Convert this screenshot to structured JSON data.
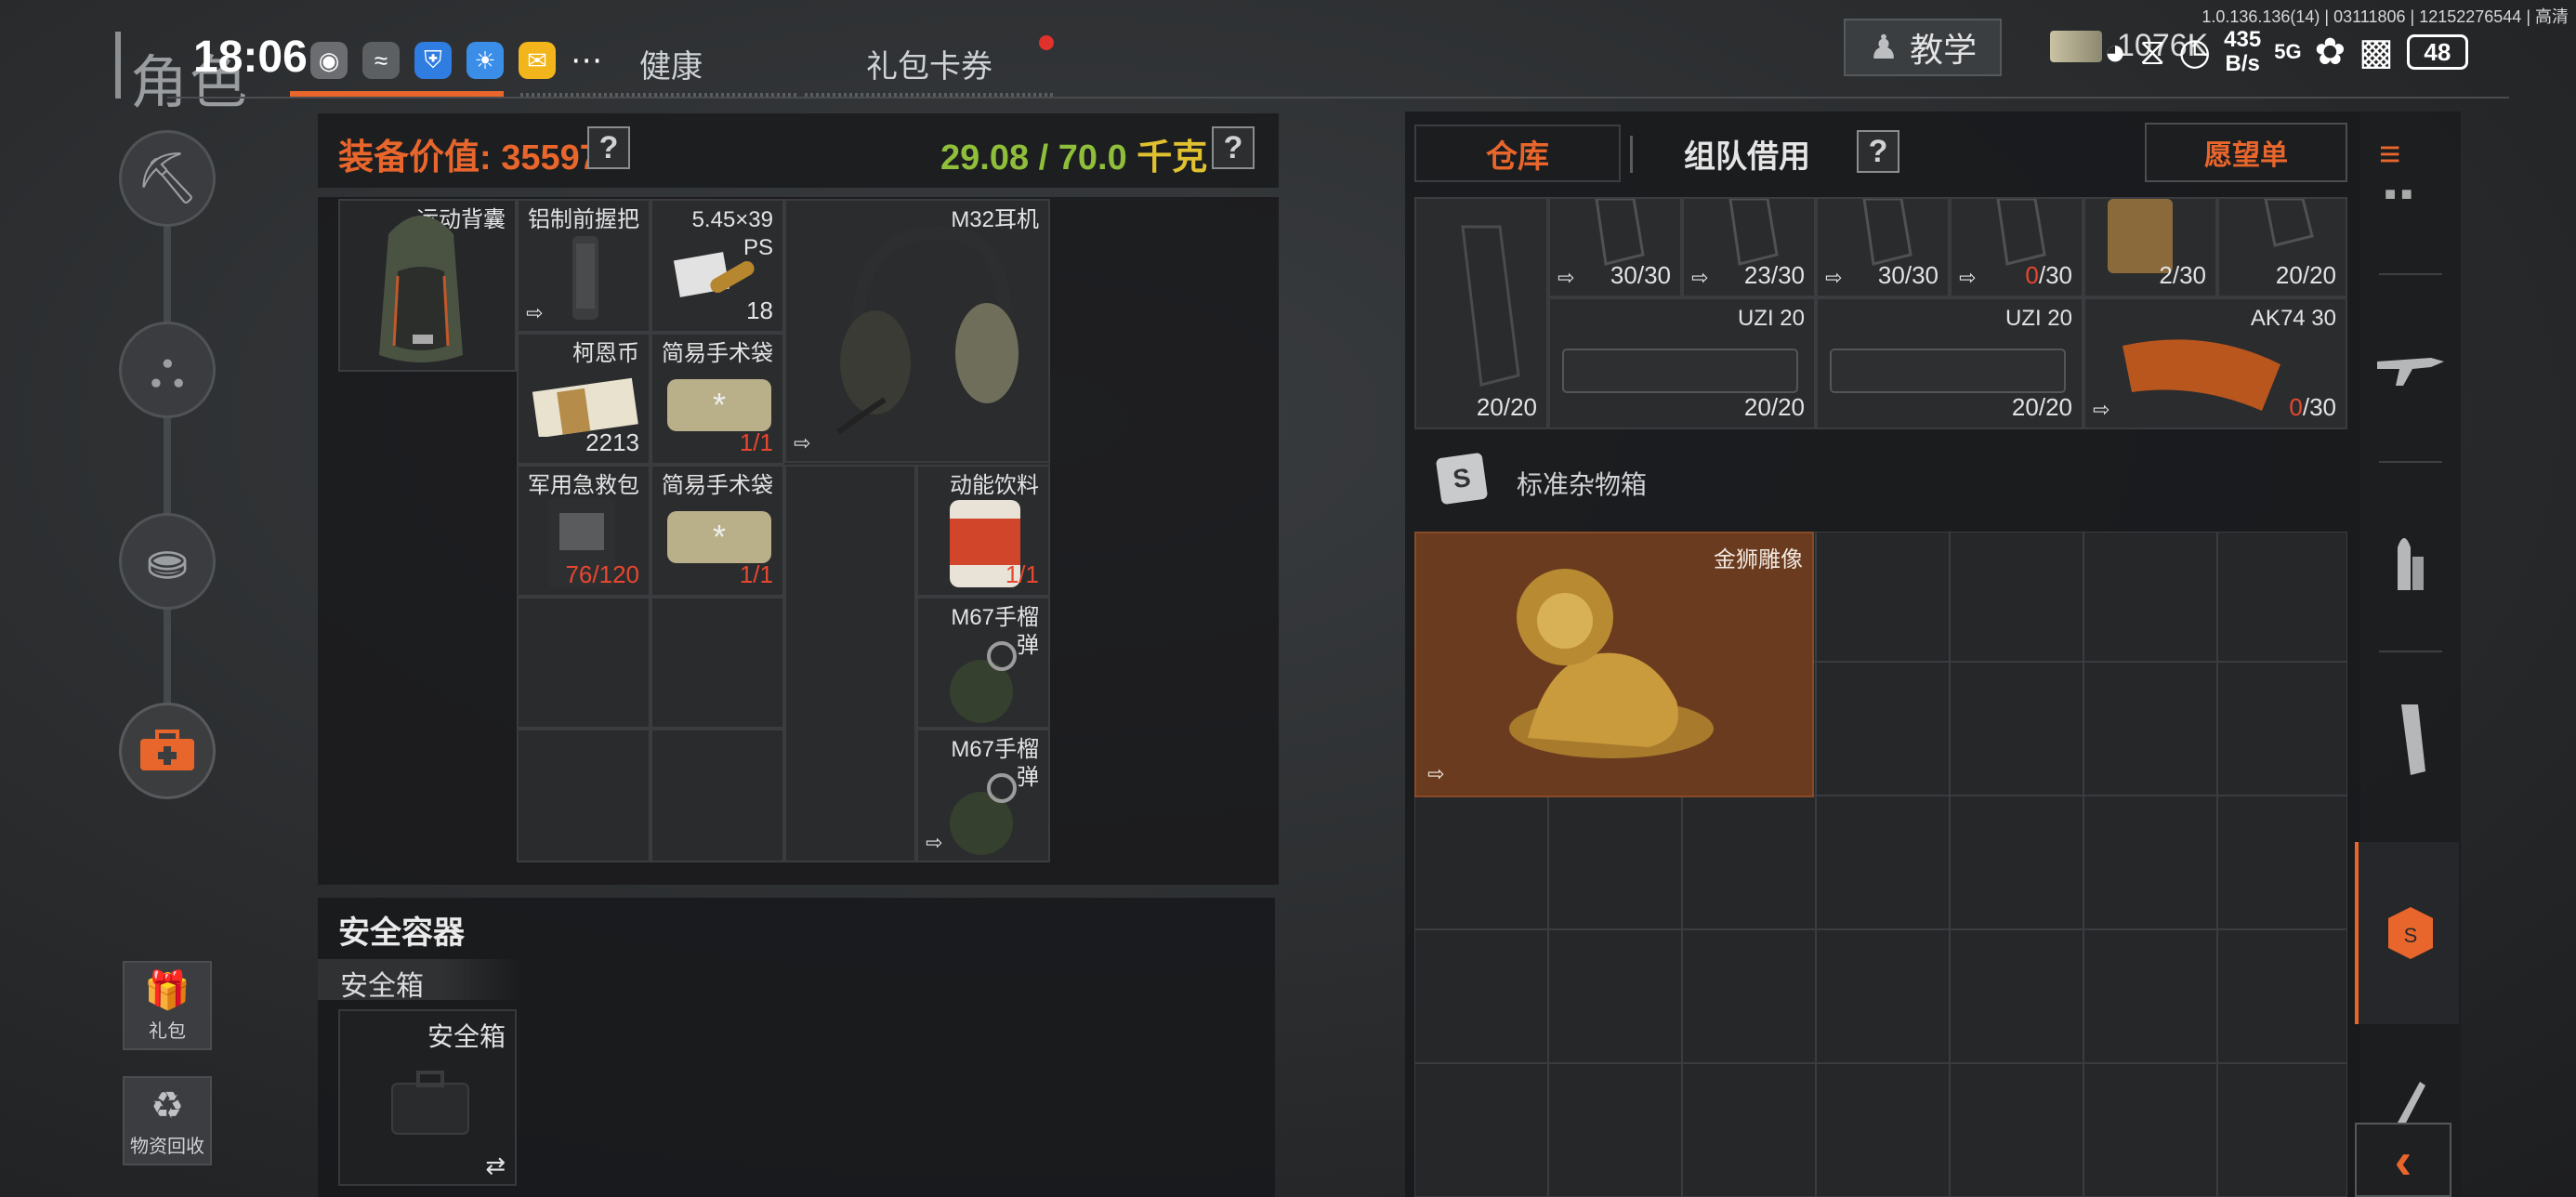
{
  "header": {
    "title": "角色",
    "tabs": [
      {
        "label": "健康"
      },
      {
        "label": "礼包卡券"
      }
    ],
    "tutorial_label": "教学",
    "currency": "1076K"
  },
  "status_bar": {
    "time": "18:06",
    "net_speed_value": "435",
    "net_speed_unit": "B/s",
    "signal": "5G",
    "battery": "48",
    "version": "1.0.136.136(14) | 03111806 | 12152276544 | 高清"
  },
  "left_nav": {
    "items": [
      {
        "name": "helmet-weapon-icon"
      },
      {
        "name": "vest-icon"
      },
      {
        "name": "backpack-icon"
      },
      {
        "name": "medkit-icon",
        "active": true
      }
    ],
    "gift_label": "礼包",
    "recycle_label": "物资回收"
  },
  "equipment": {
    "value_label": "装备价值: 35597",
    "weight_value": "29.08 / 70.0",
    "weight_unit": "千克",
    "help": "?",
    "backpack": {
      "name": "运动背囊"
    },
    "items": {
      "grip": {
        "name": "铝制前握把"
      },
      "ammo": {
        "name": "5.45×39 PS",
        "qty": "18"
      },
      "headset": {
        "name": "M32耳机"
      },
      "coin": {
        "name": "柯恩币",
        "qty": "2213"
      },
      "surgical1": {
        "name": "简易手术袋",
        "qty": "1/1"
      },
      "firstaid": {
        "name": "军用急救包",
        "qty": "76/120"
      },
      "surgical2": {
        "name": "简易手术袋",
        "qty": "1/1"
      },
      "drink": {
        "name": "动能饮料",
        "qty": "1/1"
      },
      "grenade1": {
        "name": "M67手榴弹"
      },
      "grenade2": {
        "name": "M67手榴弹"
      }
    }
  },
  "safe": {
    "title": "安全容器",
    "sub_label": "安全箱",
    "box_label": "安全箱",
    "swap_icon": "⇄"
  },
  "warehouse": {
    "tab_active": "仓库",
    "tab_team": "组队借用",
    "help": "?",
    "wishlist": "愿望单",
    "mags_row1": [
      {
        "qty": "30/30"
      },
      {
        "qty": "23/30"
      },
      {
        "qty": "30/30"
      },
      {
        "qty_red": "0",
        "qty_rest": "/30"
      },
      {
        "qty": "2/30"
      },
      {
        "qty": "20/20"
      }
    ],
    "mag_big_qty": "20/20",
    "mags_row2": [
      {
        "name": "UZI 20",
        "qty": "20/20"
      },
      {
        "name": "UZI 20",
        "qty": "20/20"
      },
      {
        "name": "AK74 30",
        "qty_red": "0",
        "qty_rest": "/30"
      }
    ],
    "misc_box_title": "标准杂物箱",
    "lion": {
      "name": "金狮雕像"
    }
  },
  "right_rail": {
    "items": [
      {
        "name": "rifle-icon"
      },
      {
        "name": "ammo-icon"
      },
      {
        "name": "magazine-icon"
      },
      {
        "name": "misc-box-icon",
        "active": true
      },
      {
        "name": "knife-icon"
      }
    ]
  }
}
